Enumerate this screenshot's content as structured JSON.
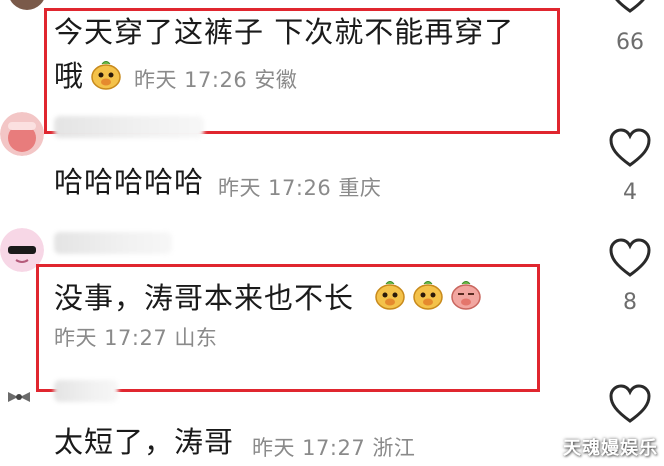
{
  "comments": [
    {
      "text_line1": "今天穿了这裤子 下次就不能再穿了",
      "text_line2": "哦",
      "time": "昨天 17:26",
      "location": "安徽"
    },
    {
      "text": "哈哈哈哈哈",
      "time": "昨天 17:26",
      "location": "重庆",
      "likes": "4"
    },
    {
      "text": "没事，涛哥本来也不长",
      "time": "昨天 17:27",
      "location": "山东",
      "likes": "8"
    },
    {
      "text": "太短了，涛哥",
      "time": "昨天 17:27",
      "location": "浙江"
    }
  ],
  "top_like_count": "66",
  "watermark": "天魂嫚娱乐",
  "colors": {
    "highlight_box": "#e0262f",
    "meta_text": "#8a8a8a"
  },
  "icons": [
    "heart-outline-icon",
    "dog-face-emoji",
    "pig-face-emoji"
  ]
}
